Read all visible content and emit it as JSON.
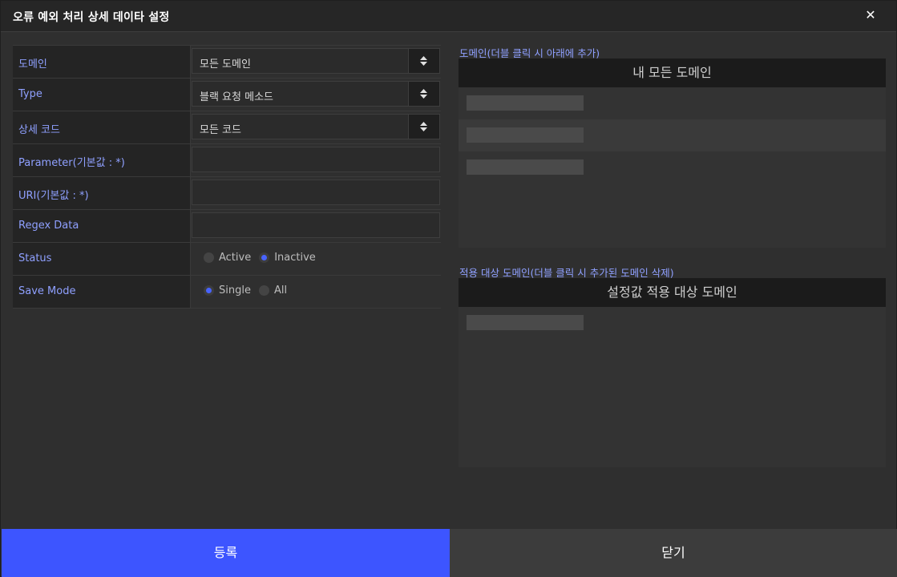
{
  "dialog": {
    "title": "오류 예외 처리 상세 데이타 설정"
  },
  "form": {
    "domain": {
      "label": "도메인",
      "value": "모든 도메인"
    },
    "type": {
      "label": "Type",
      "value": "블랙 요청 메소드"
    },
    "detail_code": {
      "label": "상세 코드",
      "value": "모든 코드"
    },
    "parameter": {
      "label": "Parameter(기본값 : *)",
      "value": ""
    },
    "uri": {
      "label": "URI(기본값 : *)",
      "value": ""
    },
    "regex": {
      "label": "Regex Data",
      "value": ""
    },
    "status": {
      "label": "Status",
      "options": [
        "Active",
        "Inactive"
      ],
      "selected": "Inactive"
    },
    "save_mode": {
      "label": "Save Mode",
      "options": [
        "Single",
        "All"
      ],
      "selected": "Single"
    }
  },
  "domains_panel": {
    "caption": "도메인(더블 클릭 시 아래에 추가)",
    "header": "내 모든 도메인"
  },
  "applied_panel": {
    "caption": "적용 대상 도메인(더블 클릭 시 추가된 도메인 삭제)",
    "header": "설정값 적용 대상 도메인"
  },
  "buttons": {
    "register": "등록",
    "close": "닫기"
  },
  "colors": {
    "accent": "#3d55ff",
    "label": "#8fa0ff",
    "radio_on": "#4863ff"
  }
}
